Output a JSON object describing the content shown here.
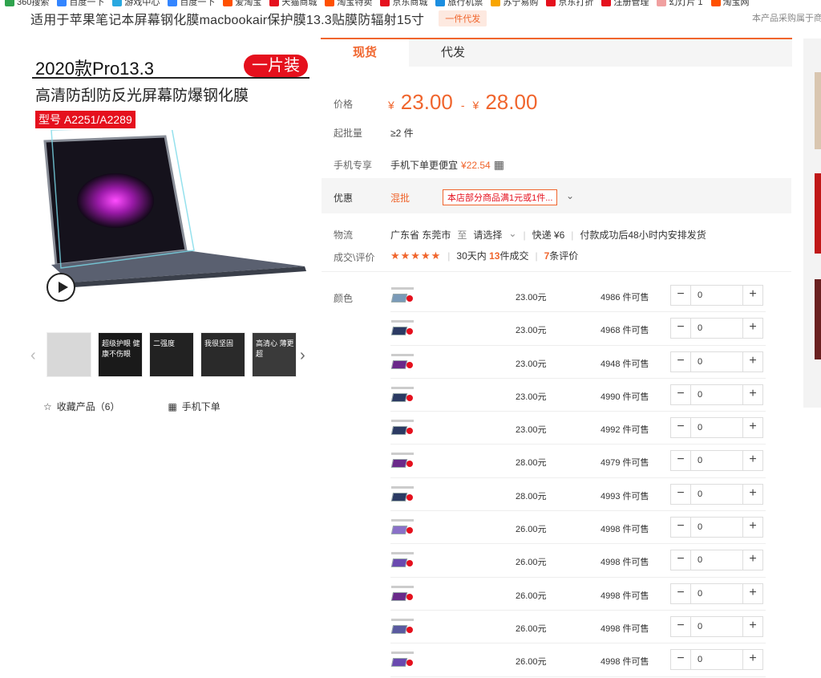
{
  "bookmarks": [
    {
      "label": "360搜索",
      "color": "#2fa34e"
    },
    {
      "label": "百度一下",
      "color": "#3385ff"
    },
    {
      "label": "游戏中心",
      "color": "#29a8e0"
    },
    {
      "label": "百度一下",
      "color": "#3385ff"
    },
    {
      "label": "爱淘宝",
      "color": "#ff5000"
    },
    {
      "label": "天猫商城",
      "color": "#e5101d"
    },
    {
      "label": "淘宝特卖",
      "color": "#ff5000"
    },
    {
      "label": "京东商城",
      "color": "#e5101d"
    },
    {
      "label": "旅行机票",
      "color": "#1b8ee0"
    },
    {
      "label": "苏宁易购",
      "color": "#f8a500"
    },
    {
      "label": "京东打折",
      "color": "#e5101d"
    },
    {
      "label": "注册管理",
      "color": "#e5101d"
    },
    {
      "label": "幻灯片 1",
      "color": "#f0a0a0"
    },
    {
      "label": "淘宝网",
      "color": "#ff5000"
    }
  ],
  "title": "适用于苹果笔记本屏幕钢化膜macbookair保护膜13.3贴膜防辐射15寸",
  "title_tag": "一件代发",
  "corner_note": "本产品采购属于商",
  "hero": {
    "title": "2020款Pro13.3",
    "badge": "一片装",
    "subtitle": "高清防刮防反光屏幕防爆钢化膜",
    "model": "型号 A2251/A2289"
  },
  "thumbs": [
    {
      "label": "",
      "bg": "#d8d8d8"
    },
    {
      "label": "超级护眼 健康不伤眼",
      "bg": "#1a1a1a"
    },
    {
      "label": "二强度",
      "bg": "#222"
    },
    {
      "label": "我很坚固",
      "bg": "#2a2a2a"
    },
    {
      "label": "高清心 薄更超",
      "bg": "#3a3a3a"
    }
  ],
  "actions": {
    "favorite": "收藏产品（6）",
    "mobile_order": "手机下单"
  },
  "tabs": [
    "现货",
    "代发"
  ],
  "price": {
    "label": "价格",
    "currency": "¥",
    "low": "23.00",
    "high": "28.00",
    "sep": "-"
  },
  "moq": {
    "label": "起批量",
    "value": "≥2 件"
  },
  "mobile": {
    "label": "手机专享",
    "text": "手机下单更便宜",
    "price": "¥22.54"
  },
  "promo": {
    "label": "优惠",
    "mix": "混批",
    "tag": "本店部分商品满1元或1件..."
  },
  "logistics": {
    "label": "物流",
    "from": "广东省 东莞市",
    "to_word": "至",
    "select": "请选择",
    "express": "快递 ¥6",
    "ship": "付款成功后48小时内安排发货"
  },
  "reviews": {
    "label": "成交\\评价",
    "stars": "★★★★★",
    "deals_prefix": "30天内",
    "deals_count": "13",
    "deals_suffix": "件成交",
    "review_count": "7",
    "review_suffix": "条评价"
  },
  "color_label": "颜色",
  "sku": [
    {
      "price": "23.00元",
      "stock": "4986 件可售",
      "qty": "0",
      "screen": "#7a9ab8"
    },
    {
      "price": "23.00元",
      "stock": "4968 件可售",
      "qty": "0",
      "screen": "#2b3a63"
    },
    {
      "price": "23.00元",
      "stock": "4948 件可售",
      "qty": "0",
      "screen": "#6a2a8a"
    },
    {
      "price": "23.00元",
      "stock": "4990 件可售",
      "qty": "0",
      "screen": "#2b3a63"
    },
    {
      "price": "23.00元",
      "stock": "4992 件可售",
      "qty": "0",
      "screen": "#2b3a63"
    },
    {
      "price": "28.00元",
      "stock": "4979 件可售",
      "qty": "0",
      "screen": "#6a2a8a"
    },
    {
      "price": "28.00元",
      "stock": "4993 件可售",
      "qty": "0",
      "screen": "#2b3a63"
    },
    {
      "price": "26.00元",
      "stock": "4998 件可售",
      "qty": "0",
      "screen": "#8a70c8"
    },
    {
      "price": "26.00元",
      "stock": "4998 件可售",
      "qty": "0",
      "screen": "#6a4ab0"
    },
    {
      "price": "26.00元",
      "stock": "4998 件可售",
      "qty": "0",
      "screen": "#6a2a8a"
    },
    {
      "price": "26.00元",
      "stock": "4998 件可售",
      "qty": "0",
      "screen": "#5a5aa0"
    },
    {
      "price": "26.00元",
      "stock": "4998 件可售",
      "qty": "0",
      "screen": "#6a4ab0"
    }
  ]
}
